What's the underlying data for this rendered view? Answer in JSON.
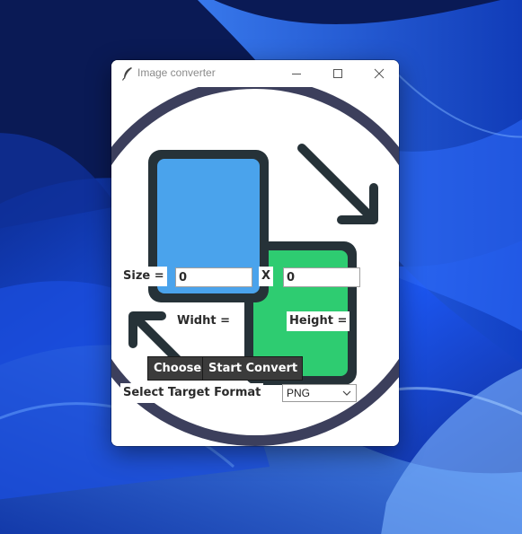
{
  "window": {
    "title": "Image converter",
    "app_icon": "feather-icon",
    "controls": [
      "minimize-icon",
      "maximize-icon",
      "close-icon"
    ]
  },
  "form": {
    "size_label": "Size =",
    "width_value": "0",
    "x_label": "X",
    "height_value": "0",
    "width_label": "Widht =",
    "height_label": "Height =",
    "choose_button": "Choose",
    "convert_button": "Start Convert",
    "format_label": "Select Target Format",
    "format_selected": "PNG"
  },
  "colors": {
    "desktop_accent": "#1e5cff",
    "art_blue": "#4aa3ec",
    "art_green": "#2ecc71",
    "art_dark": "#263238",
    "art_ring": "#3c3f5c",
    "button_bg": "#3b3b3b"
  }
}
